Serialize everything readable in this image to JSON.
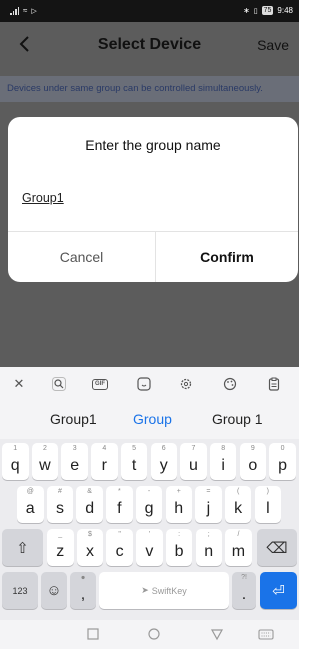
{
  "status_bar": {
    "battery": "75",
    "time": "9:48"
  },
  "nav": {
    "back_icon": "back-chevron-icon",
    "title": "Select Device",
    "save_label": "Save"
  },
  "hint": "Devices under same group can be controlled simultaneously.",
  "dialog": {
    "title": "Enter the group name",
    "input_value": "Group1",
    "cancel_label": "Cancel",
    "confirm_label": "Confirm"
  },
  "keyboard": {
    "suggestions": [
      "Group1",
      "Group",
      "Group 1"
    ],
    "row1": [
      {
        "k": "q",
        "s": "1"
      },
      {
        "k": "w",
        "s": "2"
      },
      {
        "k": "e",
        "s": "3"
      },
      {
        "k": "r",
        "s": "4"
      },
      {
        "k": "t",
        "s": "5"
      },
      {
        "k": "y",
        "s": "6"
      },
      {
        "k": "u",
        "s": "7"
      },
      {
        "k": "i",
        "s": "8"
      },
      {
        "k": "o",
        "s": "9"
      },
      {
        "k": "p",
        "s": "0"
      }
    ],
    "row2": [
      {
        "k": "a",
        "s": "@"
      },
      {
        "k": "s",
        "s": "#"
      },
      {
        "k": "d",
        "s": "&"
      },
      {
        "k": "f",
        "s": "*"
      },
      {
        "k": "g",
        "s": "-"
      },
      {
        "k": "h",
        "s": "+"
      },
      {
        "k": "j",
        "s": "="
      },
      {
        "k": "k",
        "s": "("
      },
      {
        "k": "l",
        "s": ")"
      }
    ],
    "row3": [
      {
        "k": "z",
        "s": "_"
      },
      {
        "k": "x",
        "s": "$"
      },
      {
        "k": "c",
        "s": "\""
      },
      {
        "k": "v",
        "s": "'"
      },
      {
        "k": "b",
        "s": ":"
      },
      {
        "k": "n",
        "s": ";"
      },
      {
        "k": "m",
        "s": "/"
      }
    ],
    "numbers_label": "123",
    "comma": ",",
    "period": ".",
    "space_label": "SwiftKey"
  }
}
